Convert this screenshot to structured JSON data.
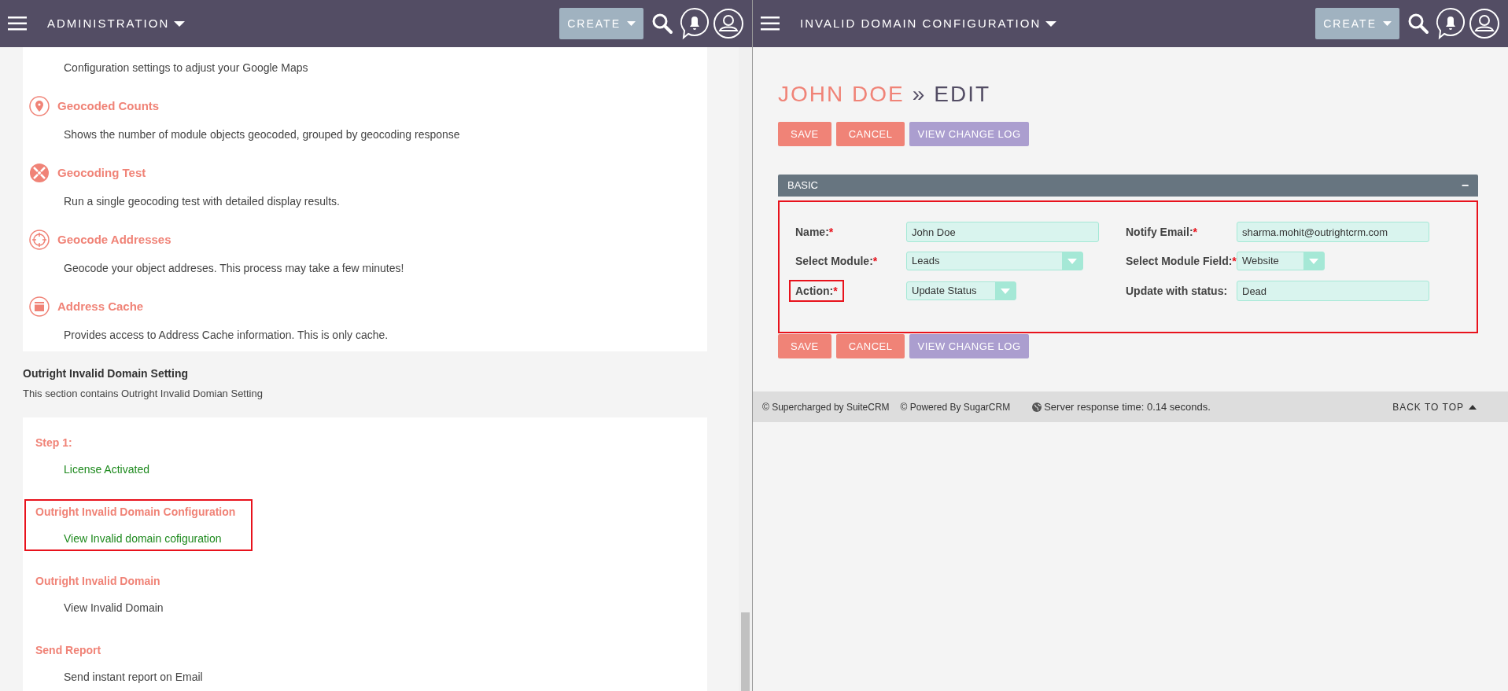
{
  "left": {
    "header": {
      "title": "ADMINISTRATION",
      "create": "CREATE"
    },
    "admin_items": [
      {
        "description": "Configuration settings to adjust your Google Maps"
      },
      {
        "title": "Geocoded Counts",
        "description": "Shows the number of module objects geocoded, grouped by geocoding response"
      },
      {
        "title": "Geocoding Test",
        "description": "Run a single geocoding test with detailed display results."
      },
      {
        "title": "Geocode Addresses",
        "description": "Geocode your object addreses. This process may take a few minutes!"
      },
      {
        "title": "Address Cache",
        "description": "Provides access to Address Cache information. This is only cache."
      }
    ],
    "section": {
      "title": "Outright Invalid Domain Setting",
      "description": "This section contains Outright Invalid Domian Setting"
    },
    "steps": [
      {
        "title": "Step 1:",
        "link": "License Activated",
        "color": "#1e8a1e",
        "highlighted": false
      },
      {
        "title": "Outright Invalid Domain Configuration",
        "link": "View Invalid domain cofiguration",
        "color": "#1e8a1e",
        "highlighted": true
      },
      {
        "title": "Outright Invalid Domain",
        "link": "View Invalid Domain",
        "color": "#444444",
        "highlighted": false
      },
      {
        "title": "Send Report",
        "link": "Send instant report on Email",
        "color": "#444444",
        "highlighted": false
      }
    ]
  },
  "right": {
    "header": {
      "title": "INVALID DOMAIN CONFIGURATION",
      "create": "CREATE"
    },
    "breadcrumb": {
      "record": "JOHN DOE",
      "separator": "»",
      "action": "EDIT"
    },
    "buttons_top": [
      "SAVE",
      "CANCEL",
      "VIEW CHANGE LOG"
    ],
    "panel": {
      "title": "BASIC",
      "collapse": "−",
      "highlighted": true,
      "fields": [
        {
          "label": "Name:",
          "required_mark": "*",
          "kind": "text",
          "value": "John Doe",
          "highlighted": false
        },
        {
          "label": "Notify Email:",
          "required_mark": "*",
          "kind": "text",
          "value": "sharma.mohit@outrightcrm.com",
          "highlighted": false
        },
        {
          "label": "Select Module:",
          "required_mark": "*",
          "kind": "select",
          "value": "Leads",
          "highlighted": false
        },
        {
          "label": "Select Module Field:",
          "required_mark": "*",
          "kind": "select",
          "value": "Website",
          "highlighted": false
        },
        {
          "label": "Action:",
          "required_mark": "*",
          "kind": "select",
          "value": "Update Status",
          "highlighted": true
        },
        {
          "label": "Update with status:",
          "kind": "text",
          "value": "Dead",
          "highlighted": false
        }
      ]
    },
    "buttons_bottom": [
      "SAVE",
      "CANCEL",
      "VIEW CHANGE LOG"
    ],
    "footer": {
      "supercharged": "© Supercharged by SuiteCRM",
      "powered": "© Powered By SugarCRM",
      "response": "Server response time: 0.14 seconds.",
      "back_to_top": "BACK TO TOP"
    }
  }
}
